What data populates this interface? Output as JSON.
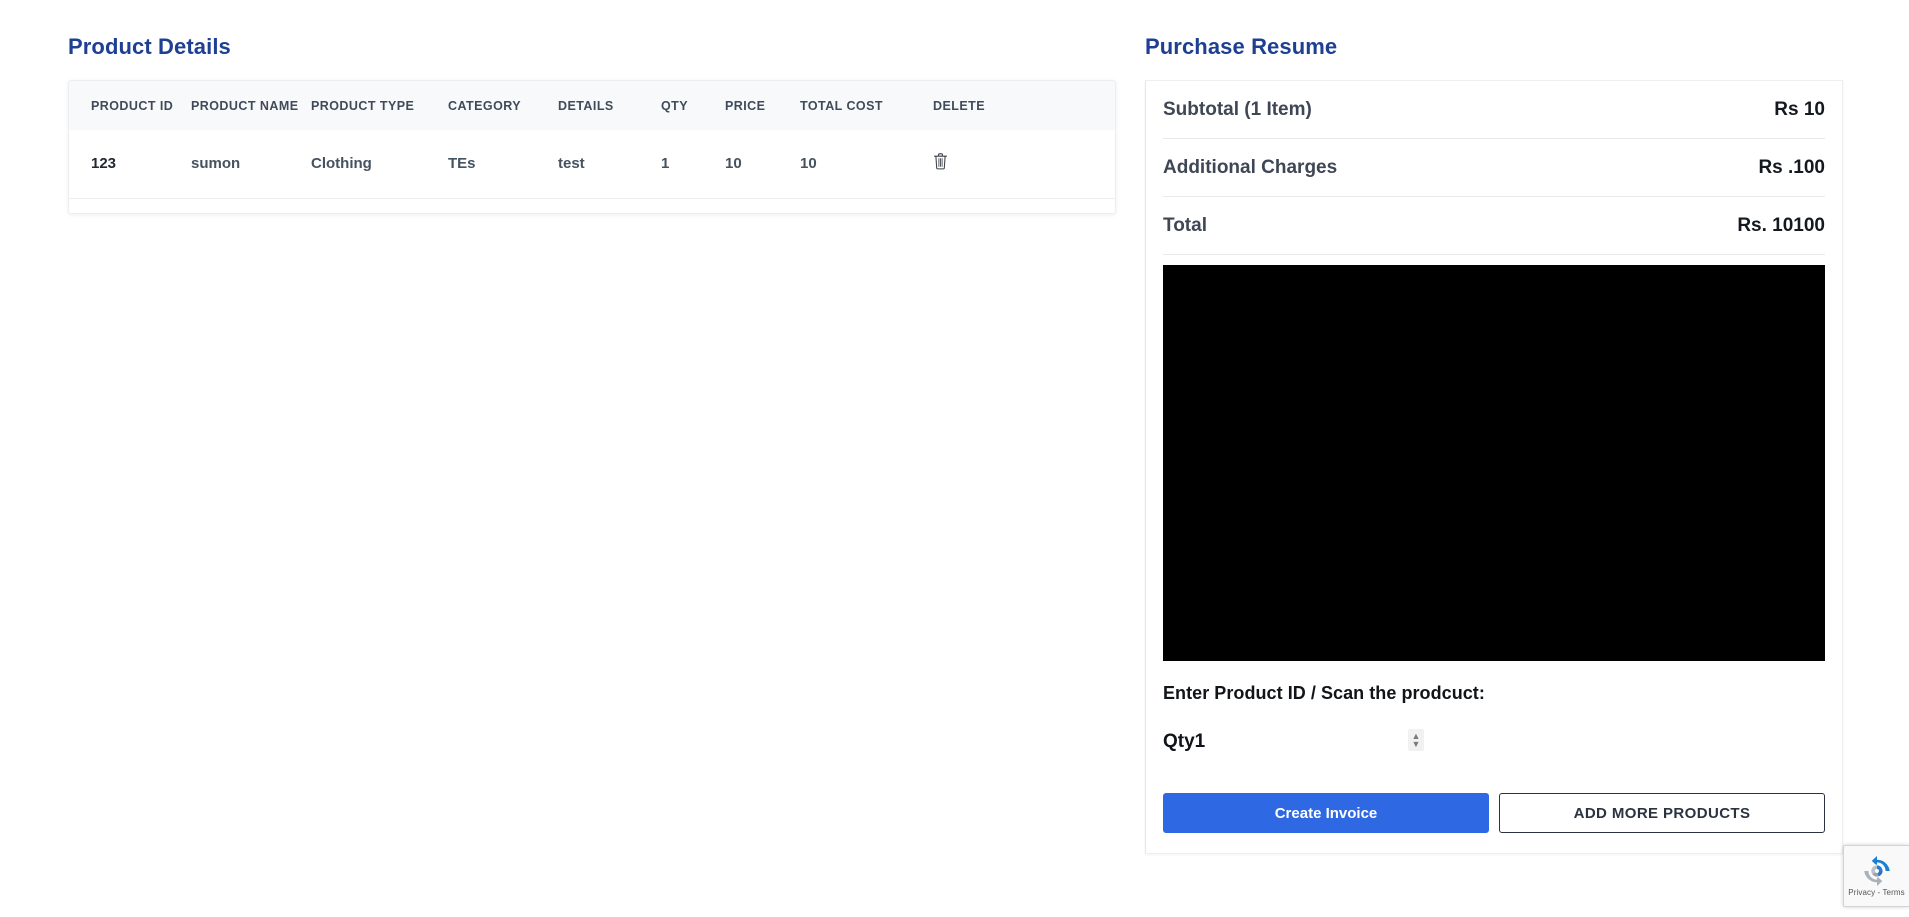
{
  "left": {
    "title": "Product Details",
    "table": {
      "columns": [
        "PRODUCT ID",
        "PRODUCT NAME",
        "PRODUCT TYPE",
        "CATEGORY",
        "DETAILS",
        "QTY",
        "PRICE",
        "TOTAL COST",
        "DELETE"
      ],
      "rows": [
        {
          "product_id": "123",
          "product_name": "sumon",
          "product_type": "Clothing",
          "category": "TEs",
          "details": "test",
          "qty": "1",
          "price": "10",
          "total_cost": "10",
          "delete_icon": "trash-icon"
        }
      ]
    }
  },
  "right": {
    "title": "Purchase Resume",
    "summary": [
      {
        "label": "Subtotal (1 Item)",
        "value": "Rs 10"
      },
      {
        "label": "Additional Charges",
        "value": "Rs .100"
      },
      {
        "label": "Total",
        "value": "Rs. 10100"
      }
    ],
    "scanner": {
      "name": "barcode-scanner-video"
    },
    "scan_label": "Enter Product ID / Scan the prodcuct:",
    "qty_label": "Qty1",
    "qty_value": "1",
    "buttons": {
      "primary": "Create Invoice",
      "secondary": "ADD MORE PRODUCTS"
    }
  },
  "recaptcha": {
    "text": "Privacy - Terms",
    "icon": "recaptcha-icon"
  },
  "colors": {
    "heading": "#1f3f93",
    "primary_button": "#2e68e3",
    "table_header_bg": "#f8f9fa",
    "text_dark": "#14181f"
  }
}
